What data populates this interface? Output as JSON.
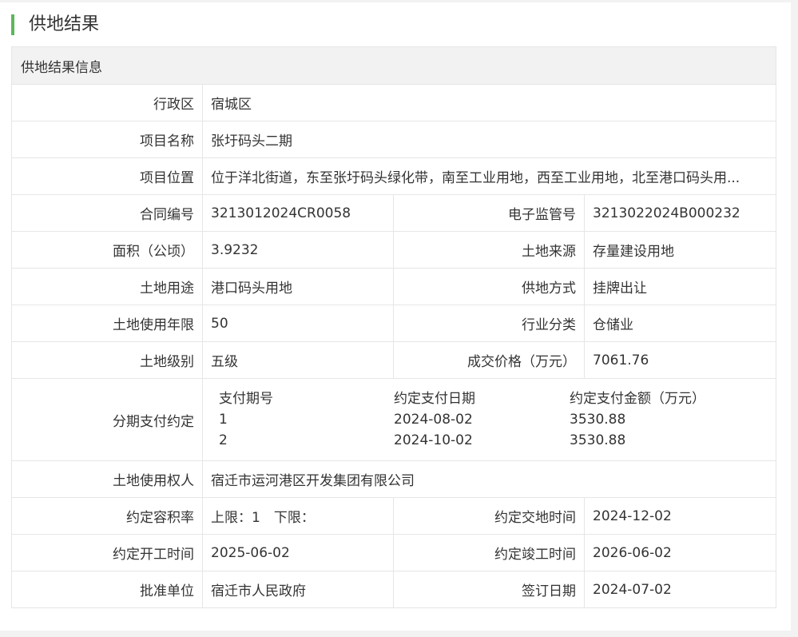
{
  "section": {
    "title": "供地结果"
  },
  "table": {
    "caption": "供地结果信息",
    "district": {
      "label": "行政区",
      "value": "宿城区"
    },
    "project_name": {
      "label": "项目名称",
      "value": "张圩码头二期"
    },
    "project_location": {
      "label": "项目位置",
      "value": "位于洋北街道，东至张圩码头绿化带，南至工业用地，西至工业用地，北至港口码头用..."
    },
    "contract_no": {
      "label": "合同编号",
      "value": "3213012024CR0058"
    },
    "supervision_no": {
      "label": "电子监管号",
      "value": "3213022024B000232"
    },
    "area": {
      "label": "面积（公顷）",
      "value": "3.9232"
    },
    "land_source": {
      "label": "土地来源",
      "value": "存量建设用地"
    },
    "land_use": {
      "label": "土地用途",
      "value": "港口码头用地"
    },
    "supply_method": {
      "label": "供地方式",
      "value": "挂牌出让"
    },
    "use_years": {
      "label": "土地使用年限",
      "value": "50"
    },
    "industry": {
      "label": "行业分类",
      "value": "仓储业"
    },
    "land_grade": {
      "label": "土地级别",
      "value": "五级"
    },
    "deal_price": {
      "label": "成交价格（万元）",
      "value": "7061.76"
    },
    "installments": {
      "label": "分期支付约定",
      "headers": [
        "支付期号",
        "约定支付日期",
        "约定支付金额（万元）"
      ],
      "rows": [
        [
          "1",
          "2024-08-02",
          "3530.88"
        ],
        [
          "2",
          "2024-10-02",
          "3530.88"
        ]
      ]
    },
    "land_user": {
      "label": "土地使用权人",
      "value": "宿迁市运河港区开发集团有限公司"
    },
    "plot_ratio": {
      "label": "约定容积率",
      "value": "上限：1　下限："
    },
    "handover_time": {
      "label": "约定交地时间",
      "value": "2024-12-02"
    },
    "start_time": {
      "label": "约定开工时间",
      "value": "2025-06-02"
    },
    "completion_time": {
      "label": "约定竣工时间",
      "value": "2026-06-02"
    },
    "approval_unit": {
      "label": "批准单位",
      "value": "宿迁市人民政府"
    },
    "sign_date": {
      "label": "签订日期",
      "value": "2024-07-02"
    }
  },
  "colors": {
    "accent": "#5cb85c",
    "caption_bg": "#f2f2f2",
    "border": "#e6e6e6"
  }
}
